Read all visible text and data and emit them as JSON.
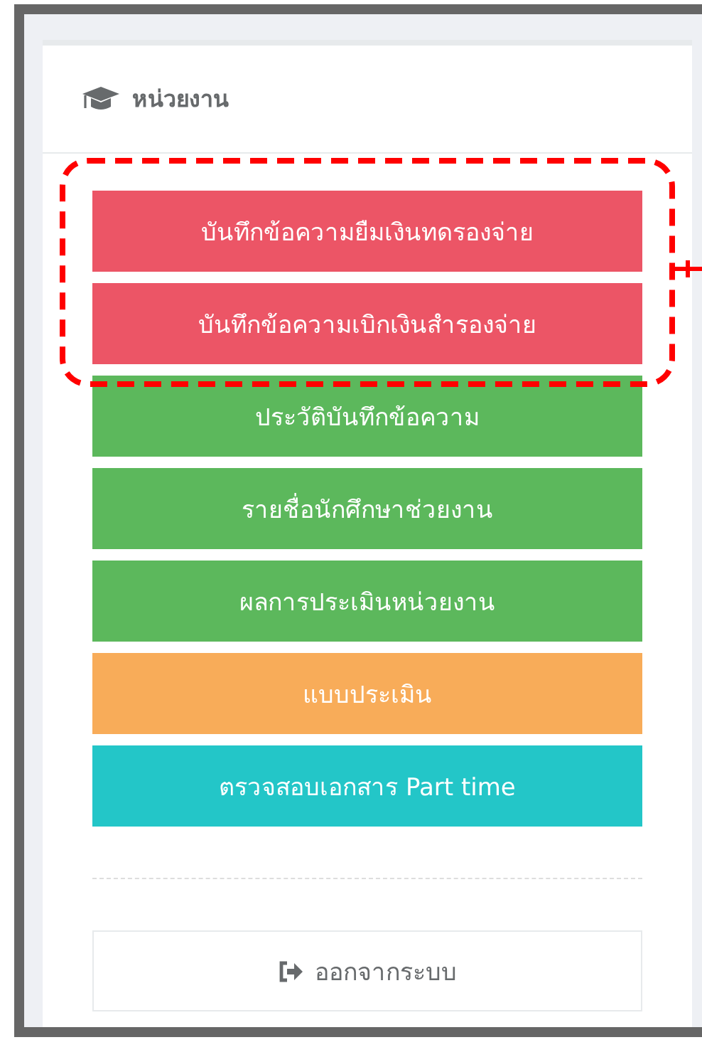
{
  "panel": {
    "title": "หน่วยงาน"
  },
  "menu": [
    {
      "label": "บันทึกข้อความยืมเงินทดรองจ่าย",
      "color": "#ec5566",
      "highlighted": true
    },
    {
      "label": "บันทึกข้อความเบิกเงินสำรองจ่าย",
      "color": "#ec5566",
      "highlighted": true
    },
    {
      "label": "ประวัติบันทึกข้อความ",
      "color": "#5cb85c",
      "highlighted": false
    },
    {
      "label": "รายชื่อนักศึกษาช่วยงาน",
      "color": "#5cb85c",
      "highlighted": false
    },
    {
      "label": "ผลการประเมินหน่วยงาน",
      "color": "#5cb85c",
      "highlighted": false
    },
    {
      "label": "แบบประเมิน",
      "color": "#f8ac59",
      "highlighted": false
    },
    {
      "label": "ตรวจสอบเอกสาร Part time",
      "color": "#23c6c8",
      "highlighted": false
    }
  ],
  "logout": {
    "label": "ออกจากระบบ"
  }
}
